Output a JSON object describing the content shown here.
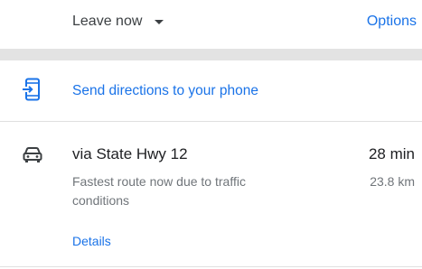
{
  "topbar": {
    "leave_now_label": "Leave now",
    "options_label": "Options"
  },
  "send": {
    "label": "Send directions to your phone",
    "icon": "send-to-phone-icon"
  },
  "route": {
    "icon": "car-icon",
    "name": "via State Hwy 12",
    "time": "28 min",
    "description": "Fastest route now due to traffic conditions",
    "distance": "23.8 km",
    "details_label": "Details"
  },
  "colors": {
    "accent": "#1a73e8",
    "text_primary": "#202124",
    "text_secondary": "#70757a",
    "separator": "#e3e3e3"
  }
}
